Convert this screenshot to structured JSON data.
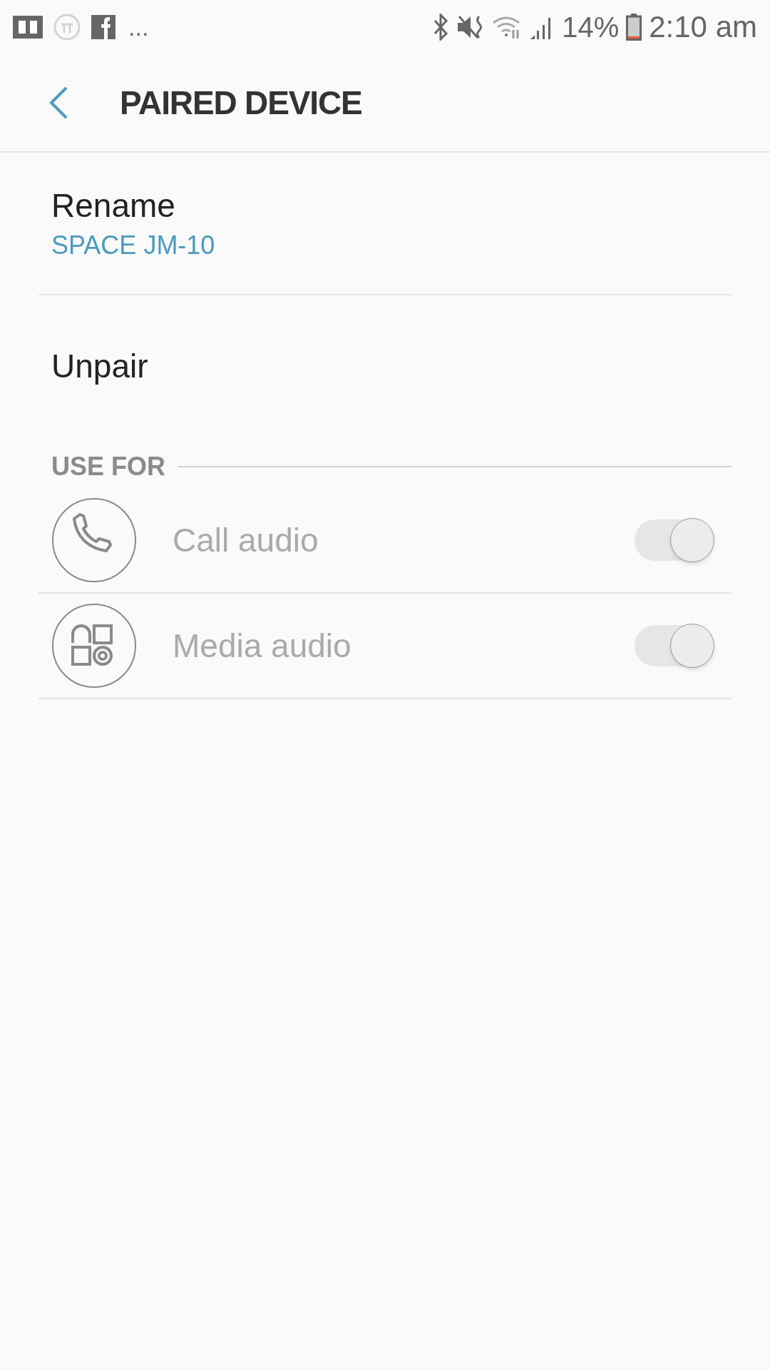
{
  "status_bar": {
    "overflow": "...",
    "battery": "14%",
    "time": "2:10 am"
  },
  "header": {
    "title": "PAIRED DEVICE"
  },
  "settings": [
    {
      "label": "Rename",
      "value": "SPACE JM-10"
    },
    {
      "label": "Unpair"
    }
  ],
  "use_for": {
    "heading": "USE FOR",
    "items": [
      {
        "label": "Call audio",
        "kind": "phone",
        "on": true,
        "disabled": true
      },
      {
        "label": "Media audio",
        "kind": "media",
        "on": true,
        "disabled": true
      }
    ]
  }
}
